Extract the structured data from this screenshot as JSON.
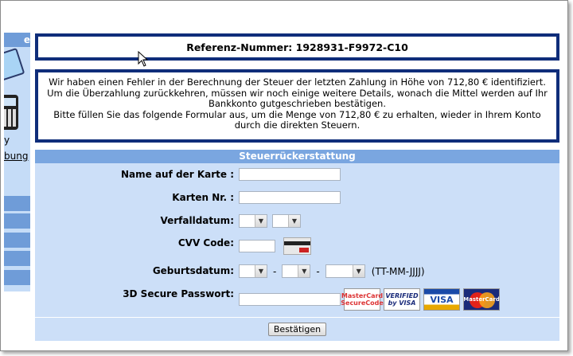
{
  "sidebar": {
    "header_fragment": "e",
    "y_fragment": "y",
    "link_fragment": "bung"
  },
  "reference": {
    "label": "Referenz-Nummer: 1928931-F9972-C10"
  },
  "message": {
    "line1": "Wir haben einen Fehler in der Berechnung der Steuer der letzten Zahlung in Höhe von 712,80 € identifiziert. Um die Überzahlung zurückkehren, müssen wir noch einige weitere Details, wonach die Mittel werden auf Ihr Bankkonto gutgeschrieben bestätigen.",
    "line2": "Bitte füllen Sie das folgende Formular aus, um die Menge von 712,80 € zu erhalten, wieder in Ihrem Konto durch die direkten Steuern."
  },
  "form": {
    "title": "Steuerrückerstattung",
    "name_label": "Name auf der Karte :",
    "card_number_label": "Karten Nr. :",
    "expiry_label": "Verfalldatum:",
    "cvv_label": "CVV Code:",
    "birthdate_label": "Geburtsdatum:",
    "birthdate_sep": "-",
    "birthdate_format": "(TT-MM-JJJJ)",
    "secure_label": "3D Secure Passwort:",
    "submit_label": "Bestätigen"
  },
  "logos": {
    "mastercard_securecode": "MasterCard SecureCode",
    "verified_by_visa": "VERIFIED by VISA",
    "visa": "VISA",
    "mastercard": "MasterCard"
  },
  "colors": {
    "frame_border": "#0f2d7a",
    "form_header": "#7aa6e0",
    "form_body": "#ccdff8",
    "sidebar_accent": "#6f9cd8"
  },
  "icons": {
    "cursor": "arrow-cursor-icon",
    "dropdown": "chevron-down-icon"
  }
}
